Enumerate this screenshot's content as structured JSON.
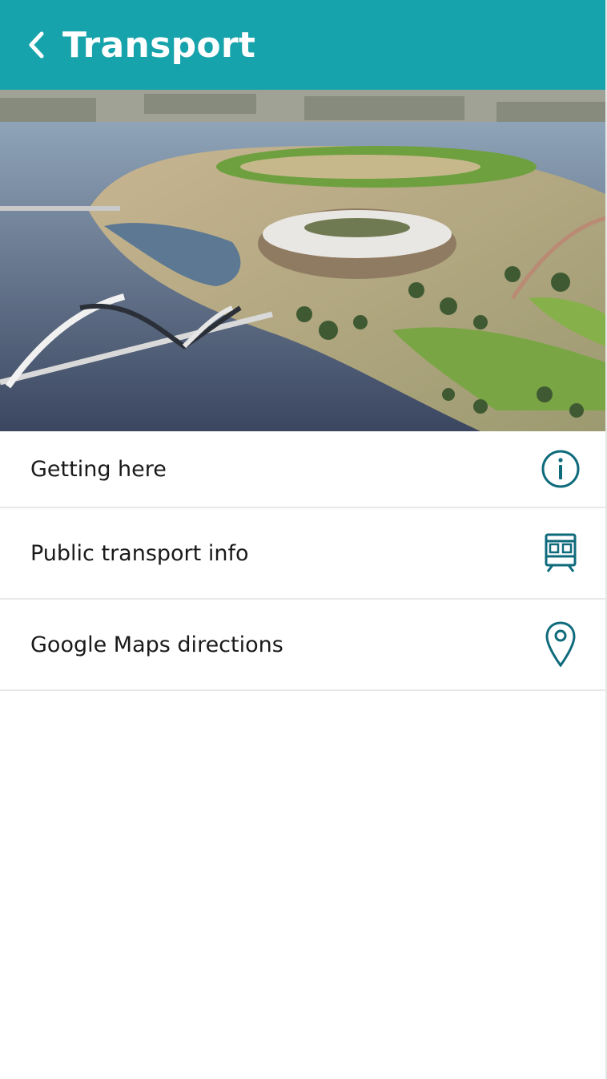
{
  "header": {
    "back_icon": "chevron-left-icon",
    "title": "Transport"
  },
  "hero": {
    "image": "aerial-stadium-photo"
  },
  "menu": {
    "items": [
      {
        "label": "Getting here",
        "icon": "info-icon"
      },
      {
        "label": "Public transport info",
        "icon": "train-icon"
      },
      {
        "label": "Google Maps directions",
        "icon": "map-pin-icon"
      }
    ]
  },
  "colors": {
    "header_bg": "#17a3ab",
    "icon": "#0f6b7c",
    "text": "#1a1a1a",
    "divider": "#e8e8e8"
  }
}
